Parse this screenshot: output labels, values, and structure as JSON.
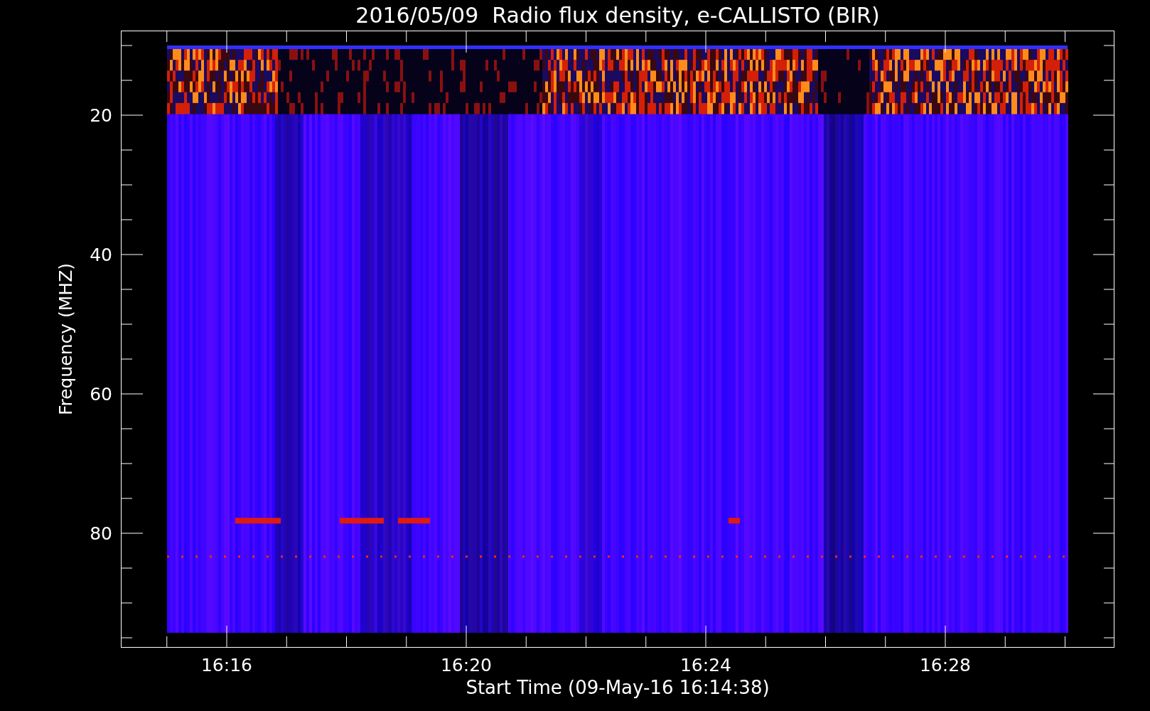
{
  "plot": {
    "title": "2016/05/09  Radio flux density, e-CALLISTO (BIR)",
    "xlabel": "Start Time (09-May-16 16:14:38)",
    "ylabel": "Frequency (MHZ)",
    "xtick_labels": [
      "16:16",
      "16:20",
      "16:24",
      "16:28"
    ],
    "ytick_labels": [
      "20",
      "40",
      "60",
      "80"
    ]
  }
}
